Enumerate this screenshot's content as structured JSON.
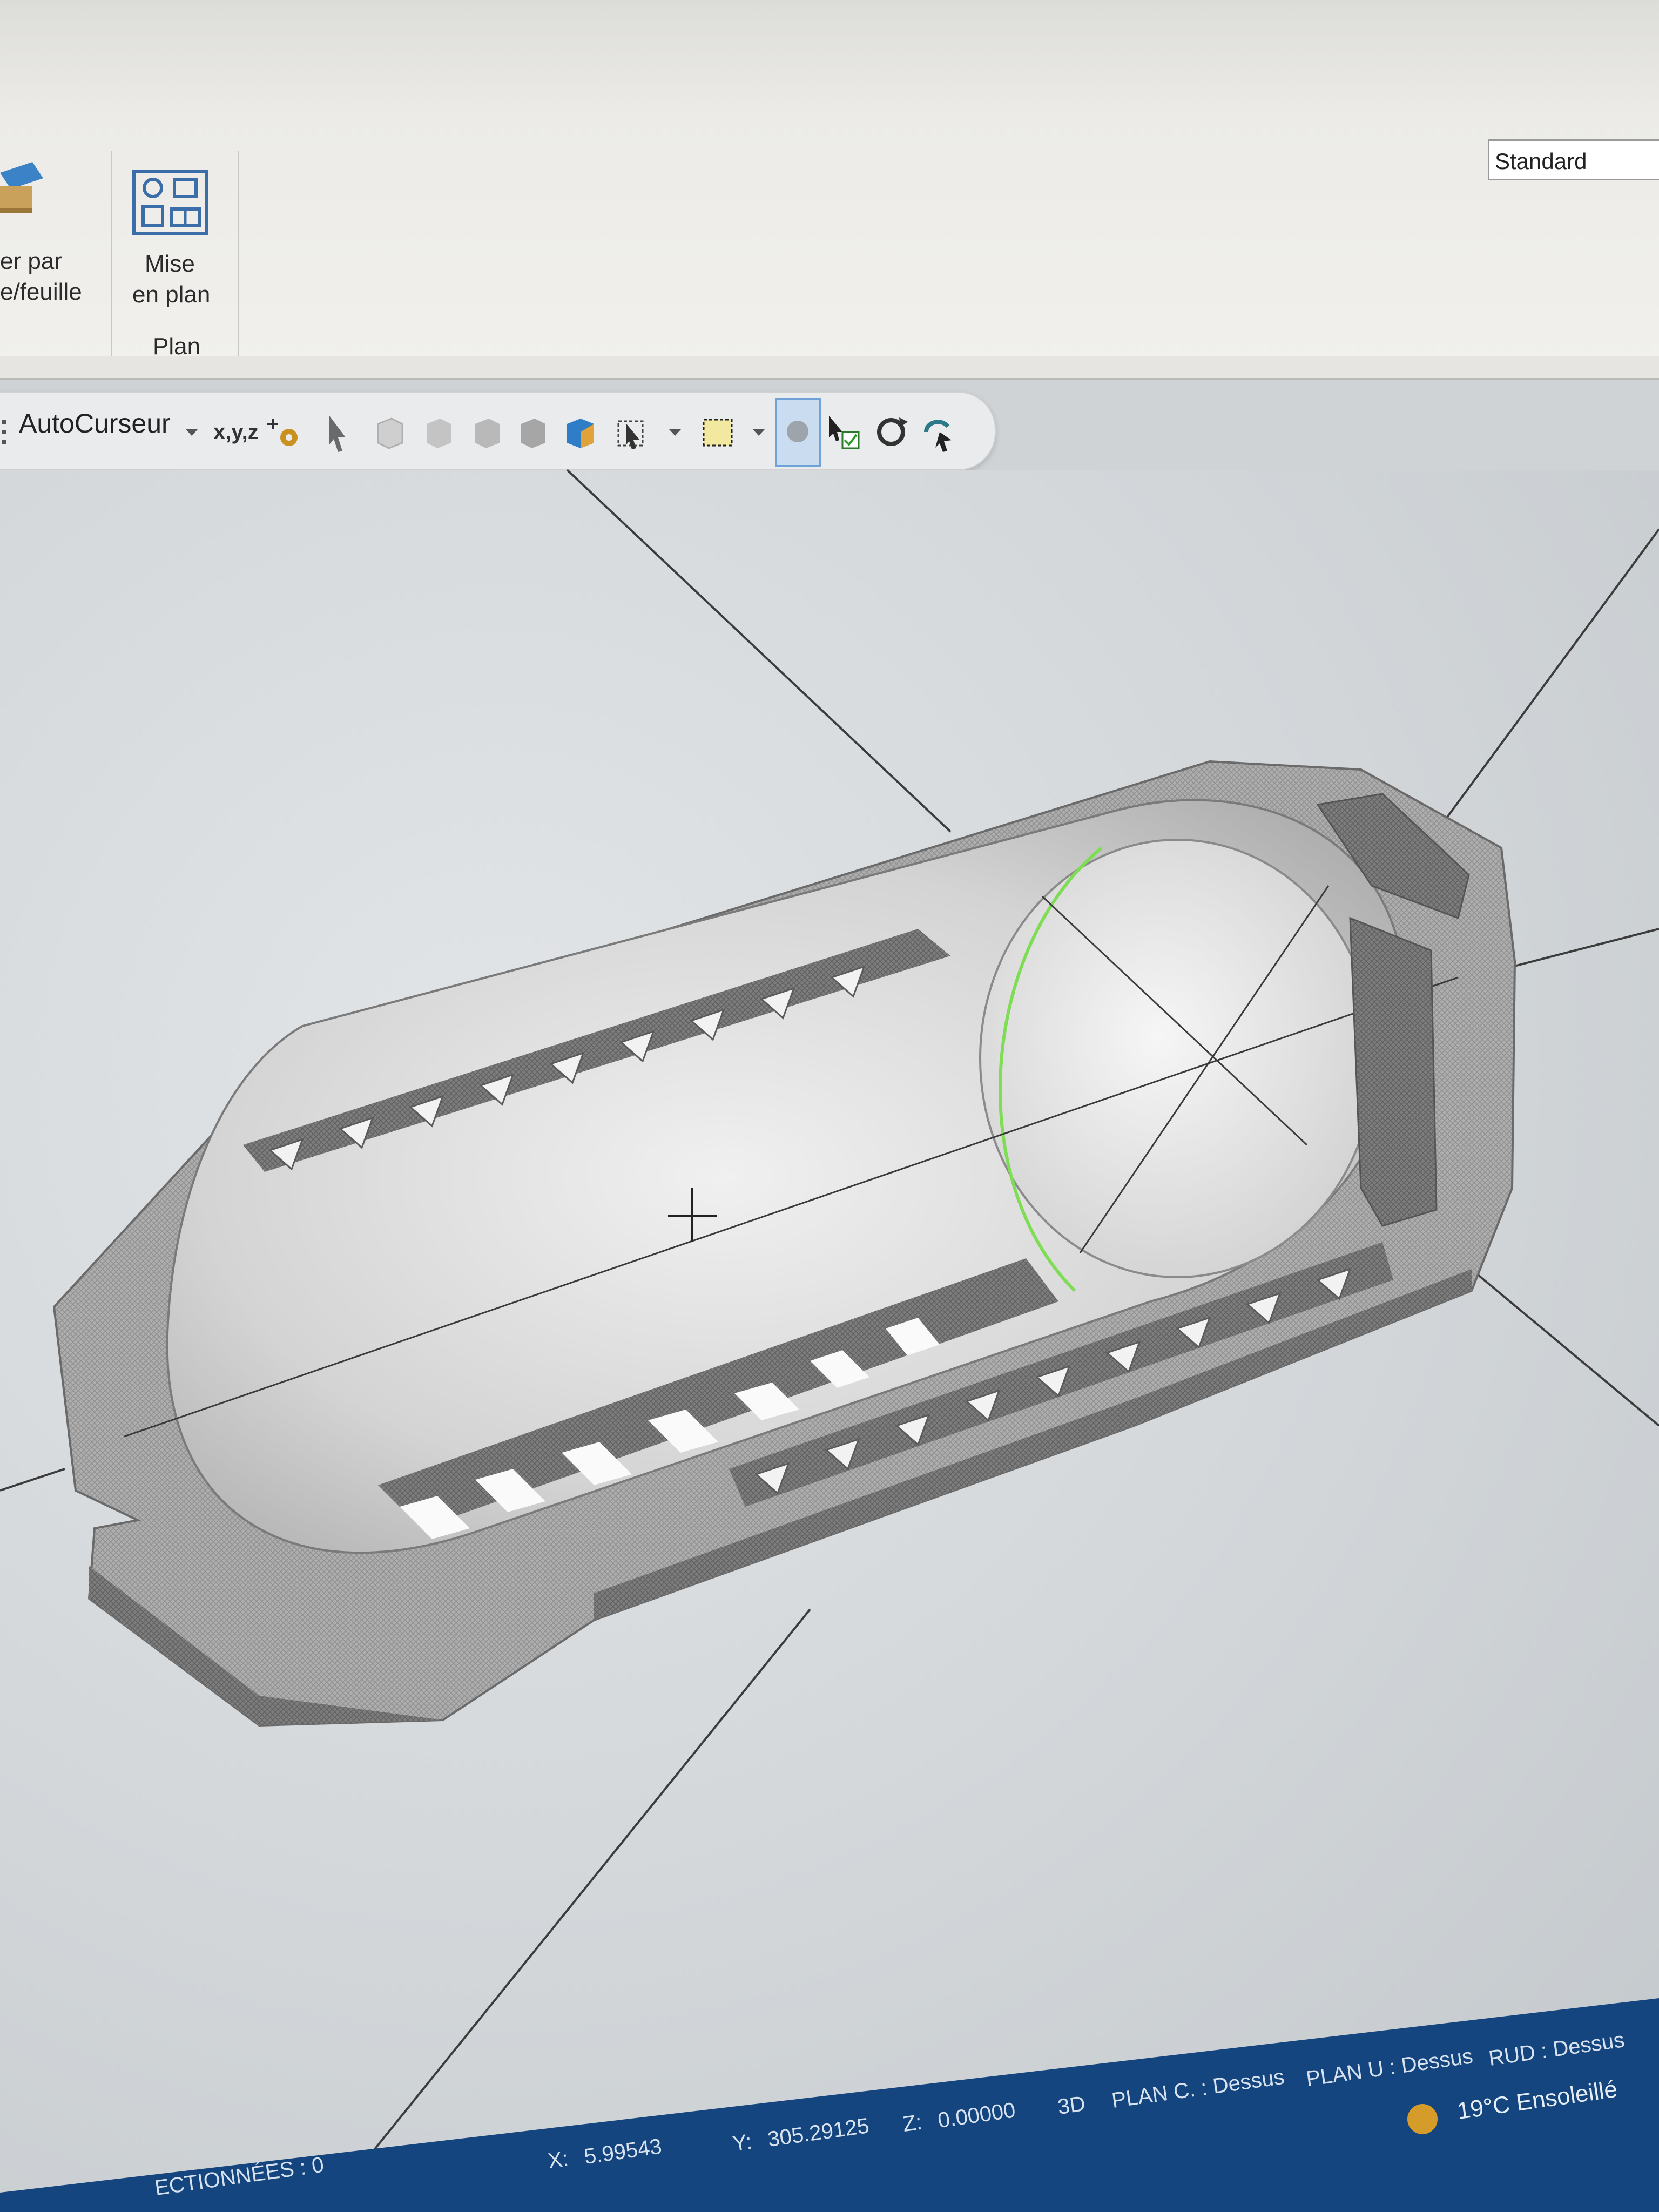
{
  "ribbon": {
    "group_left_label_line1": "er par",
    "group_left_label_line2": "e/feuille",
    "mise_en_plan_line1": "Mise",
    "mise_en_plan_line2": "en plan",
    "group_plan_label": "Plan",
    "style_select_value": "Standard"
  },
  "toolbar": {
    "autocursor_label": "AutoCurseur",
    "xyz_label": "x,y,z",
    "icons": [
      "cursor-dropdown-icon",
      "xyz-icon",
      "settings-icon",
      "select-arrow-icon",
      "cube-wire-icon",
      "cube-hidden-icon",
      "cube-shaded-icon",
      "cube-solid-icon",
      "cube-color-icon",
      "select-filter-icon",
      "box-select-icon",
      "snap-circle-icon",
      "select-check-icon",
      "rotate-view-icon",
      "undo-select-icon"
    ]
  },
  "status": {
    "selection_text": "ECTIONNÉES : 0",
    "x_label": "X:",
    "x_value": "5.99543",
    "y_label": "Y:",
    "y_value": "305.29125",
    "z_label": "Z:",
    "z_value": "0.00000",
    "view_mode": "3D",
    "plan_c": "PLAN C. : Dessus",
    "plan_u": "PLAN U : Dessus",
    "rud": "RUD : Dessus",
    "weather": "19°C  Ensoleillé"
  },
  "colors": {
    "ribbon_bg": "#efeeea",
    "viewport_bg": "#d5d9dc",
    "model_light": "#c9c9c9",
    "model_dark": "#7d7d7d",
    "statusbar_bg": "#15457e",
    "highlight_edge": "#7fdc55"
  }
}
